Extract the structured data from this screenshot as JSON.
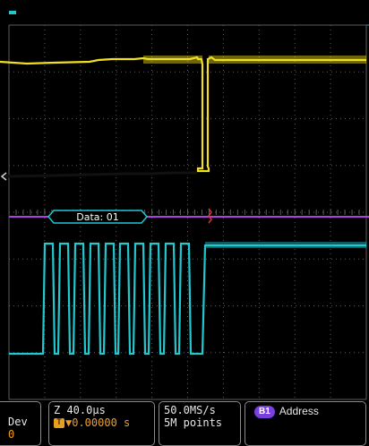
{
  "bus_decode": {
    "label": "Data: 01"
  },
  "status_bar": {
    "dev_label": "Dev",
    "dev_value": "0",
    "zoom": "Z 40.0µs",
    "trigger_glyph": "T",
    "trigger_position": "▼0.00000 s",
    "sample_rate": "50.0MS/s",
    "record_length": "5M points",
    "bus_badge": "B1",
    "bus_label": "Address"
  },
  "colors": {
    "ch1": "#f0e020",
    "ch2": "#20c8d0",
    "bus": "#b040e0",
    "grid": "#5c5c5c",
    "trigger_marker": "#e03030",
    "status_border": "#8a8a8a",
    "trigger_accent": "#f0a020"
  }
}
